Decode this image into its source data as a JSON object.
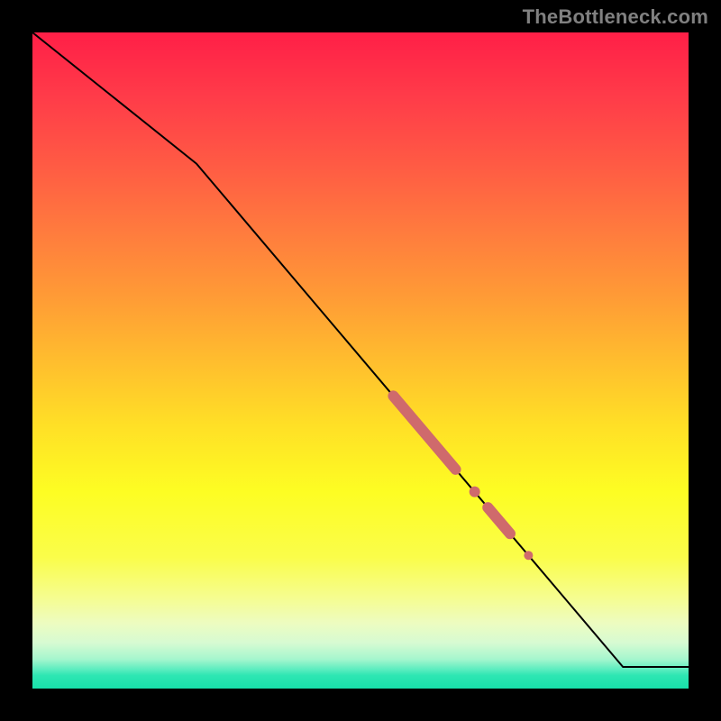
{
  "watermark": "TheBottleneck.com",
  "chart_data": {
    "type": "line",
    "title": "",
    "xlabel": "",
    "ylabel": "",
    "xlim": [
      0,
      100
    ],
    "ylim": [
      0,
      100
    ],
    "grid": false,
    "legend": false,
    "series": [
      {
        "name": "curve",
        "color": "#000000",
        "stroke_width": 2,
        "points": [
          {
            "x": 0,
            "y": 100
          },
          {
            "x": 25,
            "y": 80
          },
          {
            "x": 90,
            "y": 3.3
          },
          {
            "x": 100,
            "y": 3.3
          }
        ]
      }
    ],
    "markers": [
      {
        "name": "thick-segment-1",
        "shape": "line",
        "color": "#cf6a6c",
        "stroke_width": 12,
        "linecap": "round",
        "start": {
          "x": 55.0,
          "y": 44.6
        },
        "end": {
          "x": 64.5,
          "y": 33.4
        }
      },
      {
        "name": "dot-1",
        "shape": "circle",
        "color": "#cf6a6c",
        "center": {
          "x": 67.4,
          "y": 30.0
        },
        "radius": 6
      },
      {
        "name": "thick-segment-2",
        "shape": "line",
        "color": "#cf6a6c",
        "stroke_width": 12,
        "linecap": "round",
        "start": {
          "x": 69.4,
          "y": 27.6
        },
        "end": {
          "x": 72.8,
          "y": 23.6
        }
      },
      {
        "name": "dot-2",
        "shape": "circle",
        "color": "#cf6a6c",
        "center": {
          "x": 75.6,
          "y": 20.3
        },
        "radius": 5
      }
    ],
    "background_gradient": {
      "direction": "vertical",
      "stops": [
        {
          "pos": 0.0,
          "color": "#ff1f47"
        },
        {
          "pos": 0.5,
          "color": "#ffbd2e"
        },
        {
          "pos": 0.75,
          "color": "#fdfd30"
        },
        {
          "pos": 0.92,
          "color": "#e8fccc"
        },
        {
          "pos": 1.0,
          "color": "#18e0aa"
        }
      ]
    }
  }
}
